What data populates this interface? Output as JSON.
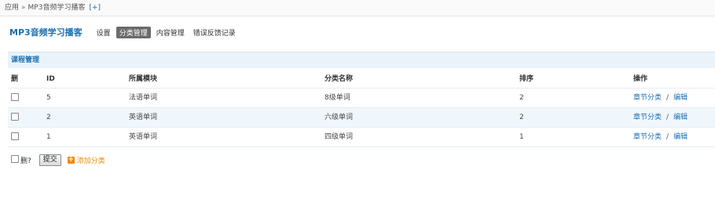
{
  "breadcrumb": {
    "root": "应用",
    "separator": "»",
    "current": "MP3音频学习播客",
    "add_label": "[+]"
  },
  "nav": {
    "title": "MP3音频学习播客",
    "items": [
      {
        "label": "设置",
        "active": false
      },
      {
        "label": "分类管理",
        "active": true
      },
      {
        "label": "内容管理",
        "active": false
      },
      {
        "label": "错误反馈记录",
        "active": false
      }
    ]
  },
  "section": {
    "title": "课程管理"
  },
  "table": {
    "headers": {
      "del": "删",
      "id": "ID",
      "module": "所属模块",
      "name": "分类名称",
      "sort": "排序",
      "ops": "操作"
    },
    "rows": [
      {
        "id": "5",
        "module": "法语单词",
        "name": "8级单词",
        "sort": "2",
        "op1": "章节分类",
        "sep": "/",
        "op2": "编辑"
      },
      {
        "id": "2",
        "module": "英语单词",
        "name": "六级单词",
        "sort": "2",
        "op1": "章节分类",
        "sep": "/",
        "op2": "编辑"
      },
      {
        "id": "1",
        "module": "英语单词",
        "name": "四级单词",
        "sort": "1",
        "op1": "章节分类",
        "sep": "/",
        "op2": "编辑"
      }
    ]
  },
  "footer": {
    "delete_label": "删?",
    "submit_label": "提交",
    "add_icon": "+",
    "add_label": "添加分类"
  },
  "colors": {
    "accent": "#1d6fb0",
    "add_orange": "#f08a00",
    "header_bg": "#eaf3fa",
    "alt_row_bg": "#f0f7fc"
  }
}
